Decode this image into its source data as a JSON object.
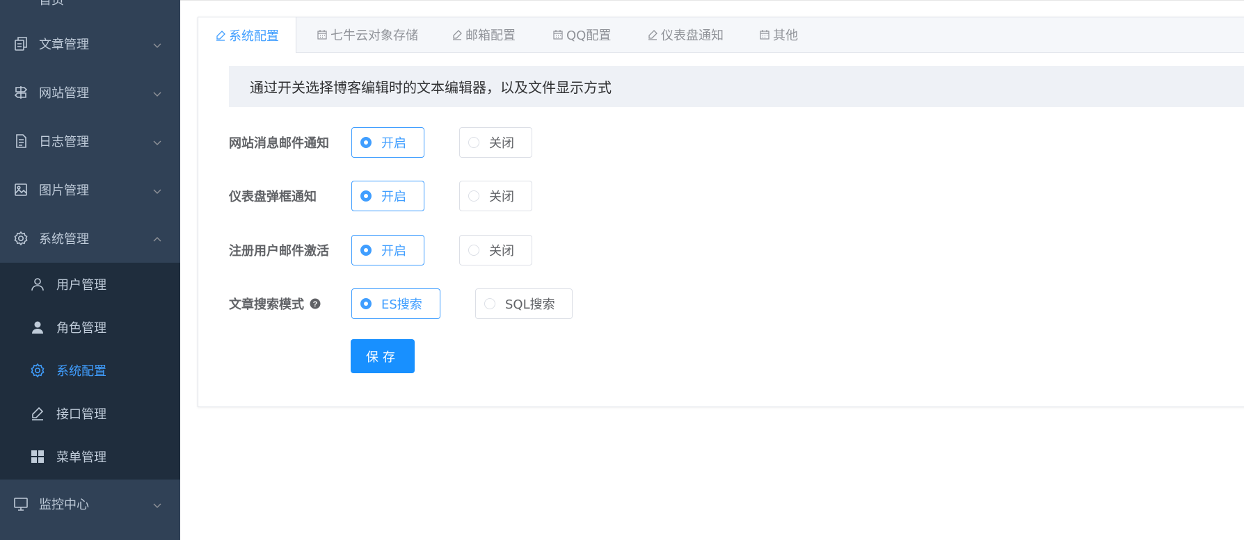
{
  "sidebar": {
    "cut_item": "首页",
    "items": [
      {
        "label": "文章管理",
        "icon": "document-copy-icon"
      },
      {
        "label": "网站管理",
        "icon": "signpost-icon"
      },
      {
        "label": "日志管理",
        "icon": "log-icon"
      },
      {
        "label": "图片管理",
        "icon": "picture-icon"
      },
      {
        "label": "系统管理",
        "icon": "gear-icon",
        "expanded": true
      },
      {
        "label": "监控中心",
        "icon": "monitor-icon"
      }
    ],
    "submenu": [
      {
        "label": "用户管理",
        "icon": "user-outline-icon"
      },
      {
        "label": "角色管理",
        "icon": "user-solid-icon"
      },
      {
        "label": "系统配置",
        "icon": "gear-icon",
        "active": true
      },
      {
        "label": "接口管理",
        "icon": "edit-icon"
      },
      {
        "label": "菜单管理",
        "icon": "grid-icon"
      }
    ]
  },
  "tabs": [
    {
      "label": "系统配置",
      "icon": "edit-icon",
      "active": true
    },
    {
      "label": "七牛云对象存储",
      "icon": "calendar-icon"
    },
    {
      "label": "邮箱配置",
      "icon": "edit-icon"
    },
    {
      "label": "QQ配置",
      "icon": "calendar-icon"
    },
    {
      "label": "仪表盘通知",
      "icon": "edit-icon"
    },
    {
      "label": "其他",
      "icon": "calendar-icon"
    }
  ],
  "notice": "通过开关选择博客编辑时的文本编辑器，以及文件显示方式",
  "form": {
    "rows": [
      {
        "label": "网站消息邮件通知",
        "options": [
          "开启",
          "关闭"
        ],
        "selected": "开启"
      },
      {
        "label": "仪表盘弹框通知",
        "options": [
          "开启",
          "关闭"
        ],
        "selected": "开启"
      },
      {
        "label": "注册用户邮件激活",
        "options": [
          "开启",
          "关闭"
        ],
        "selected": "开启"
      },
      {
        "label": "文章搜索模式",
        "options": [
          "ES搜索",
          "SQL搜索"
        ],
        "selected": "ES搜索",
        "help_icon": "question-circle-icon"
      }
    ],
    "save_label": "保存"
  },
  "colors": {
    "sidebar_bg": "#304156",
    "submenu_bg": "#1f2d3d",
    "accent": "#409eff",
    "button": "#1890ff"
  }
}
